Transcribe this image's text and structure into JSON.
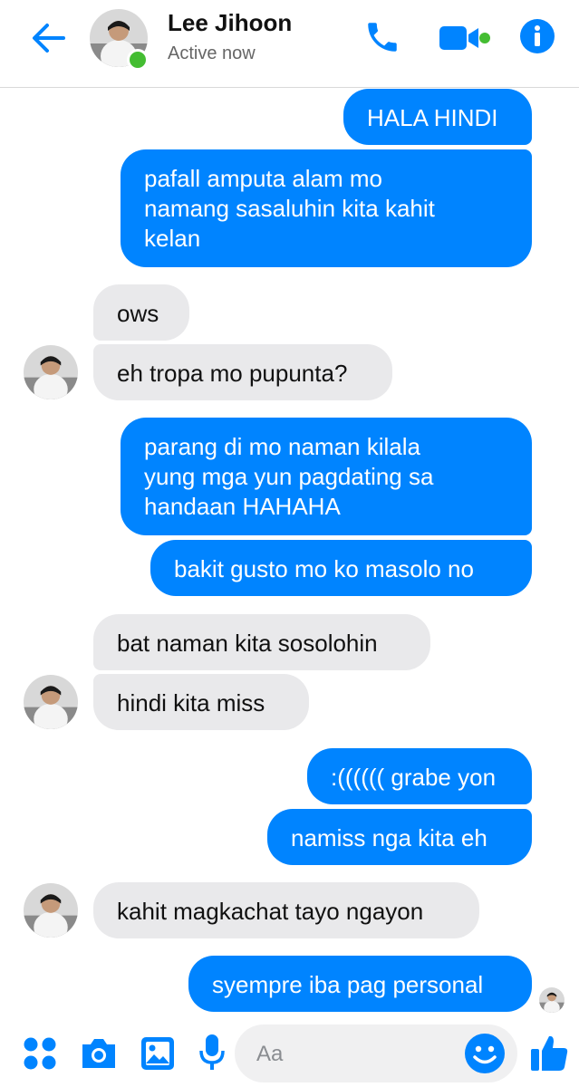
{
  "colors": {
    "accent": "#0084ff",
    "incoming_bubble": "#e9e9eb",
    "online": "#44bd32"
  },
  "header": {
    "contact_name": "Lee Jihoon",
    "status": "Active now",
    "icons": [
      "back-arrow-icon",
      "phone-icon",
      "video-camera-icon",
      "info-icon"
    ]
  },
  "messages": [
    {
      "from": "me",
      "text": "HALA HINDI"
    },
    {
      "from": "me",
      "text": "pafall amputa alam mo\nnamang sasaluhin kita kahit\nkelan"
    },
    {
      "from": "them",
      "text": "ows"
    },
    {
      "from": "them",
      "text": "eh tropa mo pupunta?"
    },
    {
      "from": "me",
      "text": "parang di mo naman kilala\nyung mga yun pagdating sa\nhandaan HAHAHA"
    },
    {
      "from": "me",
      "text": "bakit gusto mo ko masolo no"
    },
    {
      "from": "them",
      "text": "bat naman kita sosolohin"
    },
    {
      "from": "them",
      "text": "hindi kita miss"
    },
    {
      "from": "me",
      "text": ":(((((( grabe yon"
    },
    {
      "from": "me",
      "text": "namiss nga kita eh"
    },
    {
      "from": "them",
      "text": "kahit magkachat tayo ngayon"
    },
    {
      "from": "me",
      "text": "syempre iba pag personal",
      "seen": true
    }
  ],
  "composer": {
    "placeholder": "Aa",
    "icons": [
      "apps-icon",
      "camera-icon",
      "gallery-icon",
      "microphone-icon",
      "emoji-icon",
      "like-icon"
    ]
  }
}
